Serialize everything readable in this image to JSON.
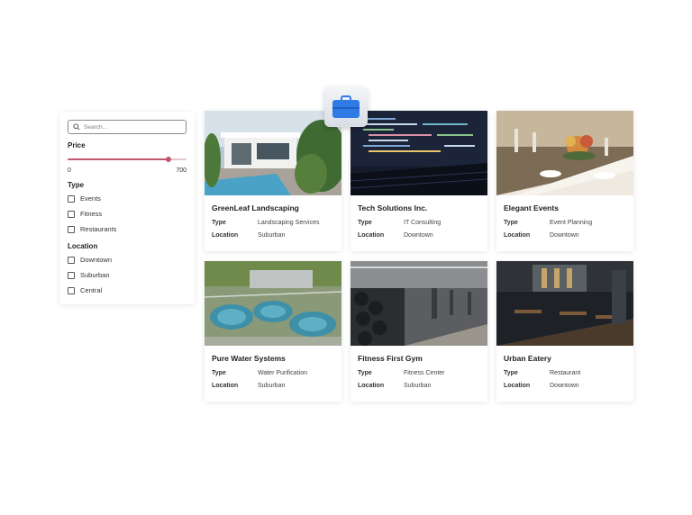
{
  "filters": {
    "search_placeholder": "Search...",
    "price_label": "Price",
    "price_min": "0",
    "price_max": "700",
    "price_value_fraction": 0.85,
    "type_label": "Type",
    "type_options": [
      "Events",
      "Fitness",
      "Restaurants"
    ],
    "location_label": "Location",
    "location_options": [
      "Downtown",
      "Suburban",
      "Central"
    ],
    "accent_color": "#c2566e"
  },
  "badge": {
    "icon": "briefcase-icon",
    "color": "#2f7be5"
  },
  "field_labels": {
    "type": "Type",
    "location": "Location"
  },
  "cards": [
    {
      "title": "GreenLeaf Landscaping",
      "type": "Landscaping Services",
      "location": "Suburban",
      "image": "modern-house-pool-photo"
    },
    {
      "title": "Tech Solutions Inc.",
      "type": "IT Consulting",
      "location": "Downtown",
      "image": "code-on-laptop-photo"
    },
    {
      "title": "Elegant Events",
      "type": "Event Planning",
      "location": "Downtown",
      "image": "banquet-table-photo"
    },
    {
      "title": "Pure Water Systems",
      "type": "Water Purification",
      "location": "Suburban",
      "image": "water-treatment-plant-photo"
    },
    {
      "title": "Fitness First Gym",
      "type": "Fitness Center",
      "location": "Suburban",
      "image": "gym-dumbbells-photo"
    },
    {
      "title": "Urban Eatery",
      "type": "Restaurant",
      "location": "Downtown",
      "image": "restaurant-interior-photo"
    }
  ]
}
